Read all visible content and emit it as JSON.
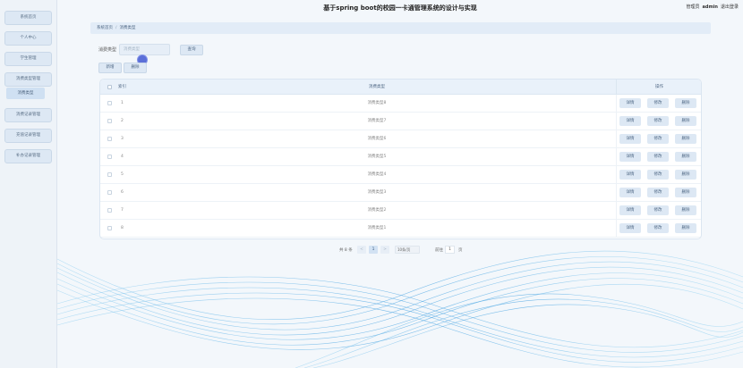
{
  "header": {
    "title": "基于spring boot的校园一卡通管理系统的设计与实现",
    "role": "管理员",
    "username": "admin",
    "logout": "退出登录"
  },
  "sidebar": {
    "items": [
      {
        "label": "系统首页"
      },
      {
        "label": "个人中心"
      },
      {
        "label": "学生管理"
      },
      {
        "label": "消费类型管理"
      },
      {
        "label": "消费记录管理"
      },
      {
        "label": "充值记录管理"
      },
      {
        "label": "补办记录管理"
      }
    ],
    "active_sub": "消费类型"
  },
  "breadcrumb": {
    "home": "系统首页",
    "current": "消费类型"
  },
  "search": {
    "label": "消费类型",
    "placeholder": "消费类型",
    "query_button": "查询"
  },
  "actions": {
    "add": "新增",
    "delete": "删除"
  },
  "table": {
    "columns": {
      "index": "索引",
      "type": "消费类型",
      "ops": "操作"
    },
    "op_labels": {
      "detail": "详情",
      "edit": "修改",
      "delete": "删除"
    },
    "rows": [
      {
        "index": "1",
        "type": "消费类型8"
      },
      {
        "index": "2",
        "type": "消费类型7"
      },
      {
        "index": "3",
        "type": "消费类型6"
      },
      {
        "index": "4",
        "type": "消费类型5"
      },
      {
        "index": "5",
        "type": "消费类型4"
      },
      {
        "index": "6",
        "type": "消费类型3"
      },
      {
        "index": "7",
        "type": "消费类型2"
      },
      {
        "index": "8",
        "type": "消费类型1"
      }
    ]
  },
  "pagination": {
    "total": "共 8 条",
    "prev": "<",
    "current_page": "1",
    "next": ">",
    "page_size": "10条/页",
    "goto_prefix": "前往",
    "goto_value": "1",
    "goto_suffix": "页"
  },
  "colors": {
    "accent": "#5b6fd8",
    "button_bg": "#dde8f4",
    "header_bg": "#e9f1fa",
    "wave": "#4fa6e0"
  }
}
